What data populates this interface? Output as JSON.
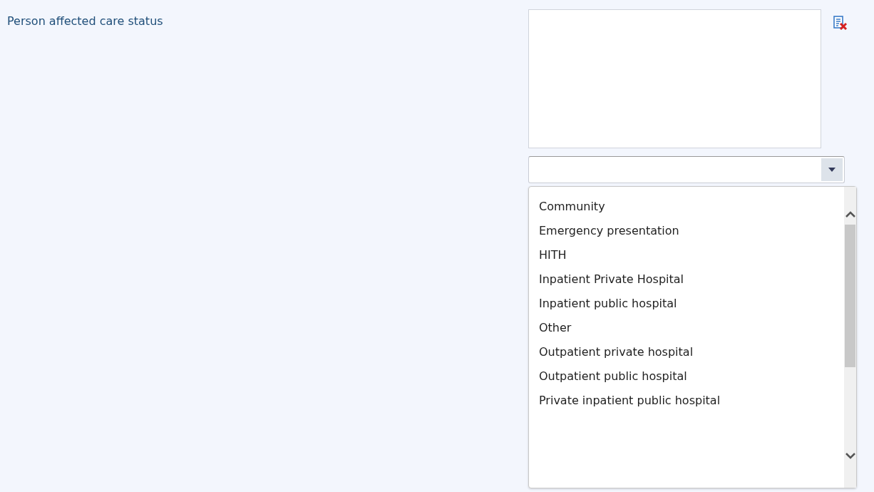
{
  "field": {
    "label": "Person affected care status"
  },
  "dropdown": {
    "options": [
      {
        "label": "Community",
        "selected": false
      },
      {
        "label": "Emergency presentation",
        "selected": false
      },
      {
        "label": "HITH",
        "selected": false
      },
      {
        "label": "Inpatient Private Hospital",
        "selected": false
      },
      {
        "label": "Inpatient public hospital",
        "selected": false
      },
      {
        "label": "Other",
        "selected": false
      },
      {
        "label": "Outpatient private hospital",
        "selected": false
      },
      {
        "label": "Outpatient public hospital",
        "selected": false
      },
      {
        "label": "Private inpatient public hospital",
        "selected": false
      }
    ]
  }
}
